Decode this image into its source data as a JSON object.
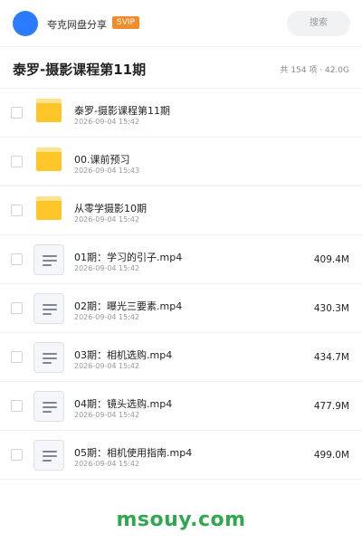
{
  "header": {
    "brand": "夸克网盘分享",
    "badge": "SVIP",
    "search_placeholder": "搜索"
  },
  "folder_title": "泰罗-摄影课程第11期",
  "summary": "共 154 项 · 42.0G",
  "items": [
    {
      "type": "folder",
      "icon": "folder-icon",
      "name": "泰罗-摄影课程第11期",
      "date": "2026-09-04 15:42",
      "size": ""
    },
    {
      "type": "folder",
      "icon": "folder-icon",
      "name": "00.课前预习",
      "date": "2026-09-04 15:43",
      "size": ""
    },
    {
      "type": "folder",
      "icon": "folder-icon",
      "name": "从零学摄影10期",
      "date": "2026-09-04 15:42",
      "size": ""
    },
    {
      "type": "file",
      "icon": "document-icon",
      "name": "01期：学习的引子.mp4",
      "date": "2026-09-04 15:42",
      "size": "409.4M"
    },
    {
      "type": "file",
      "icon": "document-icon",
      "name": "02期：曝光三要素.mp4",
      "date": "2026-09-04 15:42",
      "size": "430.3M"
    },
    {
      "type": "file",
      "icon": "document-icon",
      "name": "03期：相机选购.mp4",
      "date": "2026-09-04 15:42",
      "size": "434.7M"
    },
    {
      "type": "file",
      "icon": "document-icon",
      "name": "04期：镜头选购.mp4",
      "date": "2026-09-04 15:42",
      "size": "477.9M"
    },
    {
      "type": "file",
      "icon": "document-icon",
      "name": "05期：相机使用指南.mp4",
      "date": "2026-09-04 15:42",
      "size": "499.0M"
    }
  ],
  "watermark": "msouy.com",
  "colors": {
    "accent": "#2b7bff",
    "badge": "#f08c2b",
    "folder": "#ffc629",
    "watermark": "#2fa84f"
  }
}
